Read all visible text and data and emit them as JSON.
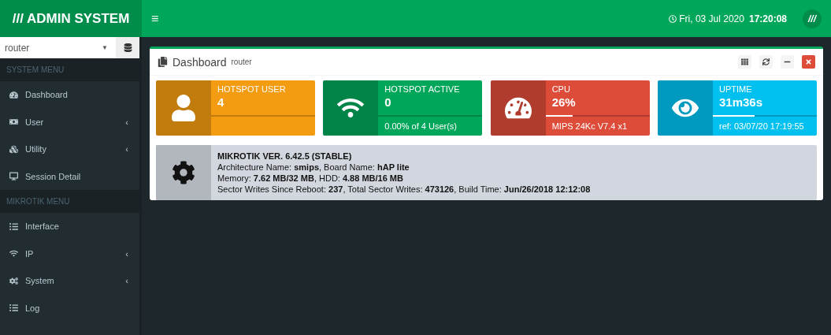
{
  "header": {
    "logo": "/// ADMIN SYSTEM",
    "menu_toggle": "≡",
    "date": "Fri, 03 Jul 2020",
    "time": "17:20:08",
    "user_badge": "///"
  },
  "sidebar": {
    "router_select": {
      "value": "router",
      "caret": "▼"
    },
    "sections": [
      {
        "title": "SYSTEM MENU",
        "items": [
          {
            "label": "Dashboard"
          },
          {
            "label": "User",
            "caret": "‹"
          },
          {
            "label": "Utility",
            "caret": "‹"
          },
          {
            "label": "Session Detail"
          }
        ]
      },
      {
        "title": "MIKROTIK MENU",
        "items": [
          {
            "label": "Interface"
          },
          {
            "label": "IP",
            "caret": "‹"
          },
          {
            "label": "System",
            "caret": "‹"
          },
          {
            "label": "Log"
          }
        ]
      }
    ]
  },
  "panel": {
    "title": "Dashboard",
    "subtitle": "router",
    "stats": [
      {
        "label": "HOTSPOT USER",
        "value": "4",
        "color": "#f39c12"
      },
      {
        "label": "HOTSPOT ACTIVE",
        "value": "0",
        "footer": "0.00% of 4 User(s)",
        "color": "#00a65a"
      },
      {
        "label": "CPU",
        "value": "26%",
        "level": 0.26,
        "footer": "MIPS 24Kc V7.4 x1",
        "color": "#dd4b39"
      },
      {
        "label": "UPTIME",
        "value": "31m36s",
        "level": 0.4,
        "footer": "ref: 03/07/20 17:19:55",
        "color": "#00c0ef"
      }
    ],
    "info": {
      "title": "MIKROTIK VER. 6.42.5 (STABLE)",
      "lines": [
        "Architecture Name: **smips**, Board Name: **hAP lite**",
        "Memory: **7.62 MB/32 MB**, HDD: **4.88 MB/16 MB**",
        "Sector Writes Since Reboot: **237**, Total Sector Writes: **473126**, Build Time: **Jun/26/2018 12:12:08**"
      ]
    }
  }
}
